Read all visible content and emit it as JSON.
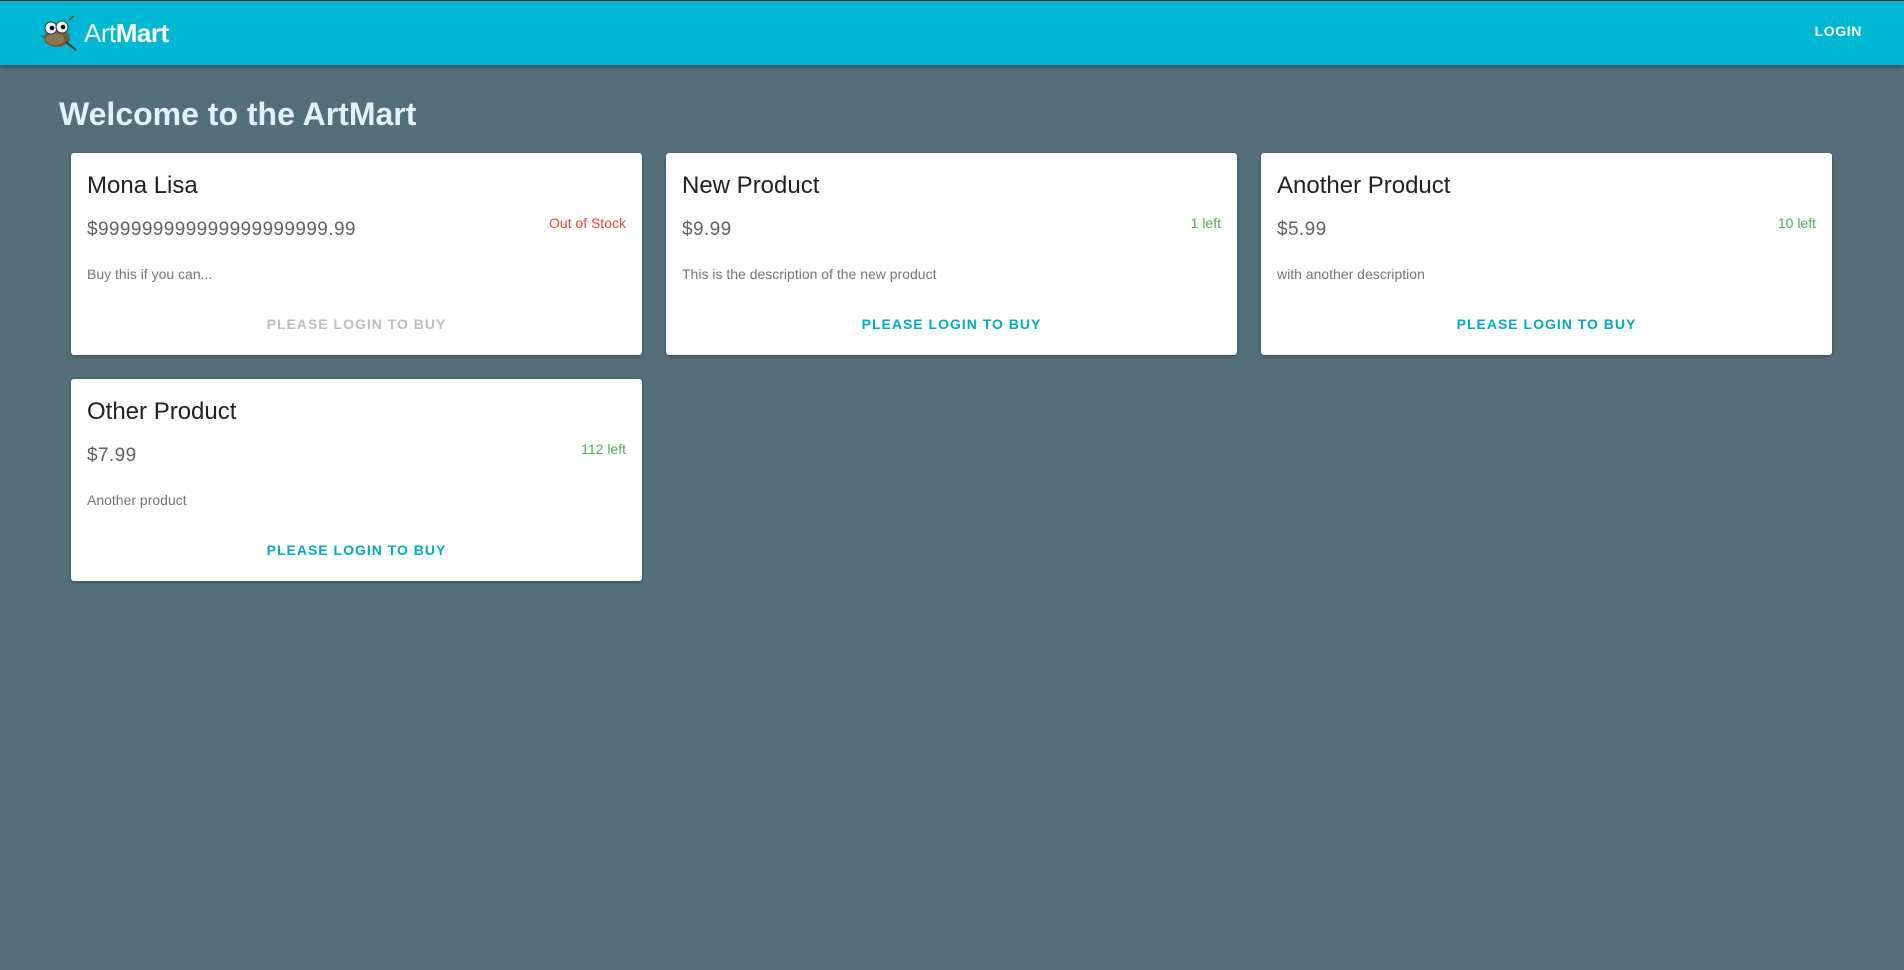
{
  "header": {
    "brand_part1": "Art",
    "brand_part2": "Mart",
    "login_label": "LOGIN"
  },
  "main": {
    "title": "Welcome to the ArtMart"
  },
  "products": [
    {
      "name": "Mona Lisa",
      "price": "$999999999999999999999.99",
      "stock": "Out of Stock",
      "description": "Buy this if you can...",
      "action": "PLEASE LOGIN TO BUY"
    },
    {
      "name": "New Product",
      "price": "$9.99",
      "stock": "1 left",
      "description": "This is the description of the new product",
      "action": "PLEASE LOGIN TO BUY"
    },
    {
      "name": "Another Product",
      "price": "$5.99",
      "stock": "10 left",
      "description": "with another description",
      "action": "PLEASE LOGIN TO BUY"
    },
    {
      "name": "Other Product",
      "price": "$7.99",
      "stock": "112 left",
      "description": "Another product",
      "action": "PLEASE LOGIN TO BUY"
    }
  ],
  "colors": {
    "appbar": "#00b8d4",
    "background": "#546e7a",
    "accent": "#00acc1",
    "in_stock": "#4caf50",
    "out_of_stock": "#f44336"
  },
  "icons": {
    "logo": "wilber-mascot-icon"
  }
}
